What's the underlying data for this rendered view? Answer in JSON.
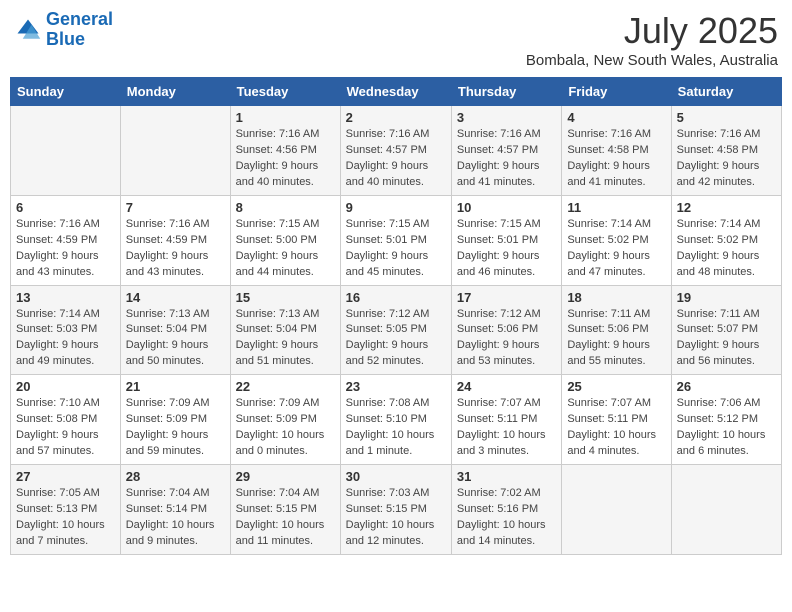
{
  "header": {
    "logo_line1": "General",
    "logo_line2": "Blue",
    "month": "July 2025",
    "location": "Bombala, New South Wales, Australia"
  },
  "columns": [
    "Sunday",
    "Monday",
    "Tuesday",
    "Wednesday",
    "Thursday",
    "Friday",
    "Saturday"
  ],
  "weeks": [
    [
      {
        "day": "",
        "info": ""
      },
      {
        "day": "",
        "info": ""
      },
      {
        "day": "1",
        "info": "Sunrise: 7:16 AM\nSunset: 4:56 PM\nDaylight: 9 hours and 40 minutes."
      },
      {
        "day": "2",
        "info": "Sunrise: 7:16 AM\nSunset: 4:57 PM\nDaylight: 9 hours and 40 minutes."
      },
      {
        "day": "3",
        "info": "Sunrise: 7:16 AM\nSunset: 4:57 PM\nDaylight: 9 hours and 41 minutes."
      },
      {
        "day": "4",
        "info": "Sunrise: 7:16 AM\nSunset: 4:58 PM\nDaylight: 9 hours and 41 minutes."
      },
      {
        "day": "5",
        "info": "Sunrise: 7:16 AM\nSunset: 4:58 PM\nDaylight: 9 hours and 42 minutes."
      }
    ],
    [
      {
        "day": "6",
        "info": "Sunrise: 7:16 AM\nSunset: 4:59 PM\nDaylight: 9 hours and 43 minutes."
      },
      {
        "day": "7",
        "info": "Sunrise: 7:16 AM\nSunset: 4:59 PM\nDaylight: 9 hours and 43 minutes."
      },
      {
        "day": "8",
        "info": "Sunrise: 7:15 AM\nSunset: 5:00 PM\nDaylight: 9 hours and 44 minutes."
      },
      {
        "day": "9",
        "info": "Sunrise: 7:15 AM\nSunset: 5:01 PM\nDaylight: 9 hours and 45 minutes."
      },
      {
        "day": "10",
        "info": "Sunrise: 7:15 AM\nSunset: 5:01 PM\nDaylight: 9 hours and 46 minutes."
      },
      {
        "day": "11",
        "info": "Sunrise: 7:14 AM\nSunset: 5:02 PM\nDaylight: 9 hours and 47 minutes."
      },
      {
        "day": "12",
        "info": "Sunrise: 7:14 AM\nSunset: 5:02 PM\nDaylight: 9 hours and 48 minutes."
      }
    ],
    [
      {
        "day": "13",
        "info": "Sunrise: 7:14 AM\nSunset: 5:03 PM\nDaylight: 9 hours and 49 minutes."
      },
      {
        "day": "14",
        "info": "Sunrise: 7:13 AM\nSunset: 5:04 PM\nDaylight: 9 hours and 50 minutes."
      },
      {
        "day": "15",
        "info": "Sunrise: 7:13 AM\nSunset: 5:04 PM\nDaylight: 9 hours and 51 minutes."
      },
      {
        "day": "16",
        "info": "Sunrise: 7:12 AM\nSunset: 5:05 PM\nDaylight: 9 hours and 52 minutes."
      },
      {
        "day": "17",
        "info": "Sunrise: 7:12 AM\nSunset: 5:06 PM\nDaylight: 9 hours and 53 minutes."
      },
      {
        "day": "18",
        "info": "Sunrise: 7:11 AM\nSunset: 5:06 PM\nDaylight: 9 hours and 55 minutes."
      },
      {
        "day": "19",
        "info": "Sunrise: 7:11 AM\nSunset: 5:07 PM\nDaylight: 9 hours and 56 minutes."
      }
    ],
    [
      {
        "day": "20",
        "info": "Sunrise: 7:10 AM\nSunset: 5:08 PM\nDaylight: 9 hours and 57 minutes."
      },
      {
        "day": "21",
        "info": "Sunrise: 7:09 AM\nSunset: 5:09 PM\nDaylight: 9 hours and 59 minutes."
      },
      {
        "day": "22",
        "info": "Sunrise: 7:09 AM\nSunset: 5:09 PM\nDaylight: 10 hours and 0 minutes."
      },
      {
        "day": "23",
        "info": "Sunrise: 7:08 AM\nSunset: 5:10 PM\nDaylight: 10 hours and 1 minute."
      },
      {
        "day": "24",
        "info": "Sunrise: 7:07 AM\nSunset: 5:11 PM\nDaylight: 10 hours and 3 minutes."
      },
      {
        "day": "25",
        "info": "Sunrise: 7:07 AM\nSunset: 5:11 PM\nDaylight: 10 hours and 4 minutes."
      },
      {
        "day": "26",
        "info": "Sunrise: 7:06 AM\nSunset: 5:12 PM\nDaylight: 10 hours and 6 minutes."
      }
    ],
    [
      {
        "day": "27",
        "info": "Sunrise: 7:05 AM\nSunset: 5:13 PM\nDaylight: 10 hours and 7 minutes."
      },
      {
        "day": "28",
        "info": "Sunrise: 7:04 AM\nSunset: 5:14 PM\nDaylight: 10 hours and 9 minutes."
      },
      {
        "day": "29",
        "info": "Sunrise: 7:04 AM\nSunset: 5:15 PM\nDaylight: 10 hours and 11 minutes."
      },
      {
        "day": "30",
        "info": "Sunrise: 7:03 AM\nSunset: 5:15 PM\nDaylight: 10 hours and 12 minutes."
      },
      {
        "day": "31",
        "info": "Sunrise: 7:02 AM\nSunset: 5:16 PM\nDaylight: 10 hours and 14 minutes."
      },
      {
        "day": "",
        "info": ""
      },
      {
        "day": "",
        "info": ""
      }
    ]
  ]
}
